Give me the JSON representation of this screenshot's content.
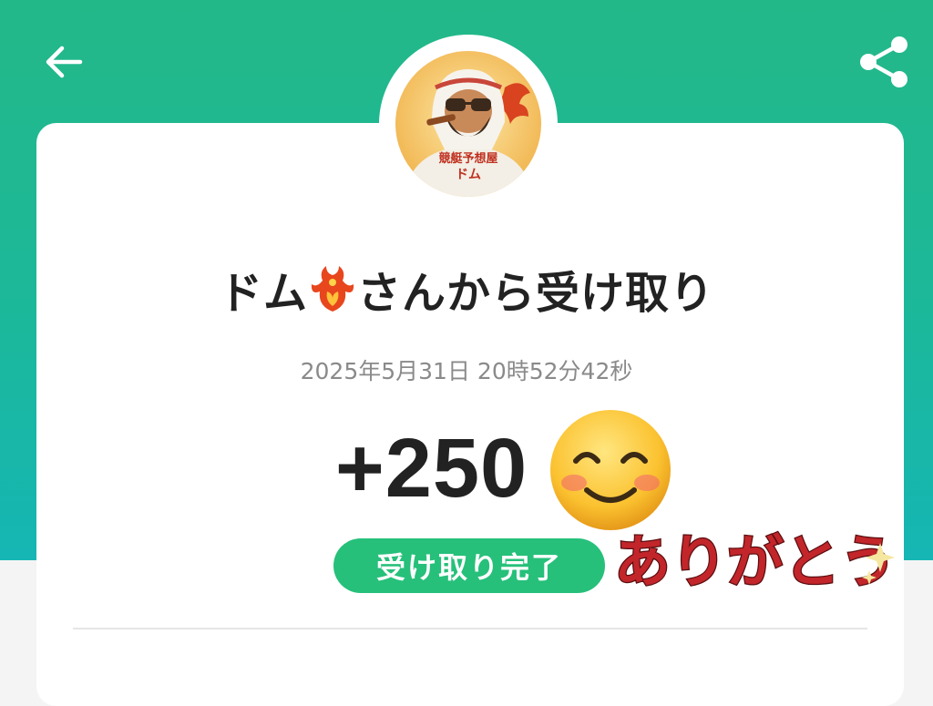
{
  "header": {
    "back_icon": "arrow-left-icon",
    "share_icon": "share-icon",
    "background_color": "#1eb894"
  },
  "sender": {
    "name": "ドム",
    "emoji": "phoenix-emoji",
    "suffix": "さんから受け取り",
    "avatar": {
      "badge_line1": "競艇予想屋",
      "badge_line2": "ドム"
    }
  },
  "transaction": {
    "timestamp": "2025年5月31日 20時52分42秒",
    "amount": "+250",
    "status": "受け取り完了",
    "status_color": "#26c07a"
  },
  "stickers": {
    "smiley": "smiling-face-emoji",
    "thanks_text": "ありがとう"
  }
}
